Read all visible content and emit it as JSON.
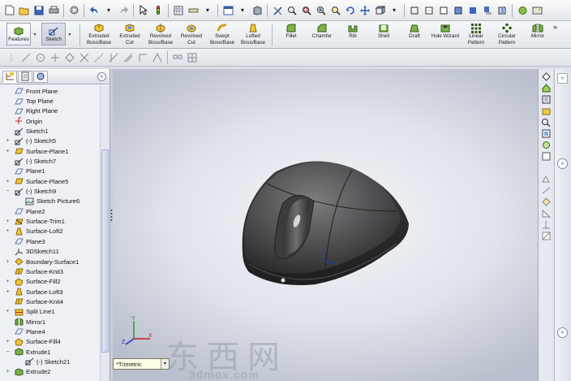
{
  "ribbon": {
    "features_label": "Features",
    "sketch_label": "Sketch",
    "buttons": [
      {
        "line1": "Extruded",
        "line2": "Boss/Base"
      },
      {
        "line1": "Extruded",
        "line2": "Cut"
      },
      {
        "line1": "Revolved",
        "line2": "Boss/Base"
      },
      {
        "line1": "Revolved",
        "line2": "Cut"
      },
      {
        "line1": "Swept",
        "line2": "Boss/Base"
      },
      {
        "line1": "Lofted",
        "line2": "Boss/Base"
      }
    ],
    "buttons2": [
      {
        "line1": "Fillet",
        "line2": ""
      },
      {
        "line1": "Chamfer",
        "line2": ""
      },
      {
        "line1": "Rib",
        "line2": ""
      },
      {
        "line1": "Shell",
        "line2": ""
      },
      {
        "line1": "Draft",
        "line2": ""
      },
      {
        "line1": "Hole Wizard",
        "line2": ""
      },
      {
        "line1": "Linear",
        "line2": "Pattern"
      },
      {
        "line1": "Circular",
        "line2": "Pattern"
      },
      {
        "line1": "Mirror",
        "line2": ""
      }
    ],
    "more": "»"
  },
  "feature_tree": {
    "collapse": "«",
    "items": [
      {
        "label": "Front Plane"
      },
      {
        "label": "Top Plane"
      },
      {
        "label": "Right Plane"
      },
      {
        "label": "Origin"
      },
      {
        "label": "Sketch1"
      },
      {
        "label": "(-) Sketch5"
      },
      {
        "label": "Surface-Plane1"
      },
      {
        "label": "(-) Sketch7"
      },
      {
        "label": "Plane1"
      },
      {
        "label": "Surface-Plane5"
      },
      {
        "label": "(-) Sketch9"
      },
      {
        "label": "Sketch Picture6"
      },
      {
        "label": "Plane2"
      },
      {
        "label": "Surface-Trim1"
      },
      {
        "label": "Surface-Loft2"
      },
      {
        "label": "Plane3"
      },
      {
        "label": "3DSketch11"
      },
      {
        "label": "Boundary-Surface1"
      },
      {
        "label": "Surface-Knit3"
      },
      {
        "label": "Surface-Fill2"
      },
      {
        "label": "Surface-Loft3"
      },
      {
        "label": "Surface-Knit4"
      },
      {
        "label": "Split Line1"
      },
      {
        "label": "Mirror1"
      },
      {
        "label": "Plane4"
      },
      {
        "label": "Surface-Fill4"
      },
      {
        "label": "Extrude1"
      },
      {
        "label": "(-) Sketch21"
      },
      {
        "label": "Extrude2"
      }
    ]
  },
  "viewport": {
    "view_name": "*Trimetric",
    "view_arrow": "▾",
    "triad": {
      "x": "X",
      "y": "Y",
      "z": "Z"
    }
  },
  "watermark": {
    "cn": "东西网",
    "url": "3dmox.com"
  },
  "taskpane": {
    "top_arrow": "»",
    "collapse": "«",
    "expand": "»"
  }
}
